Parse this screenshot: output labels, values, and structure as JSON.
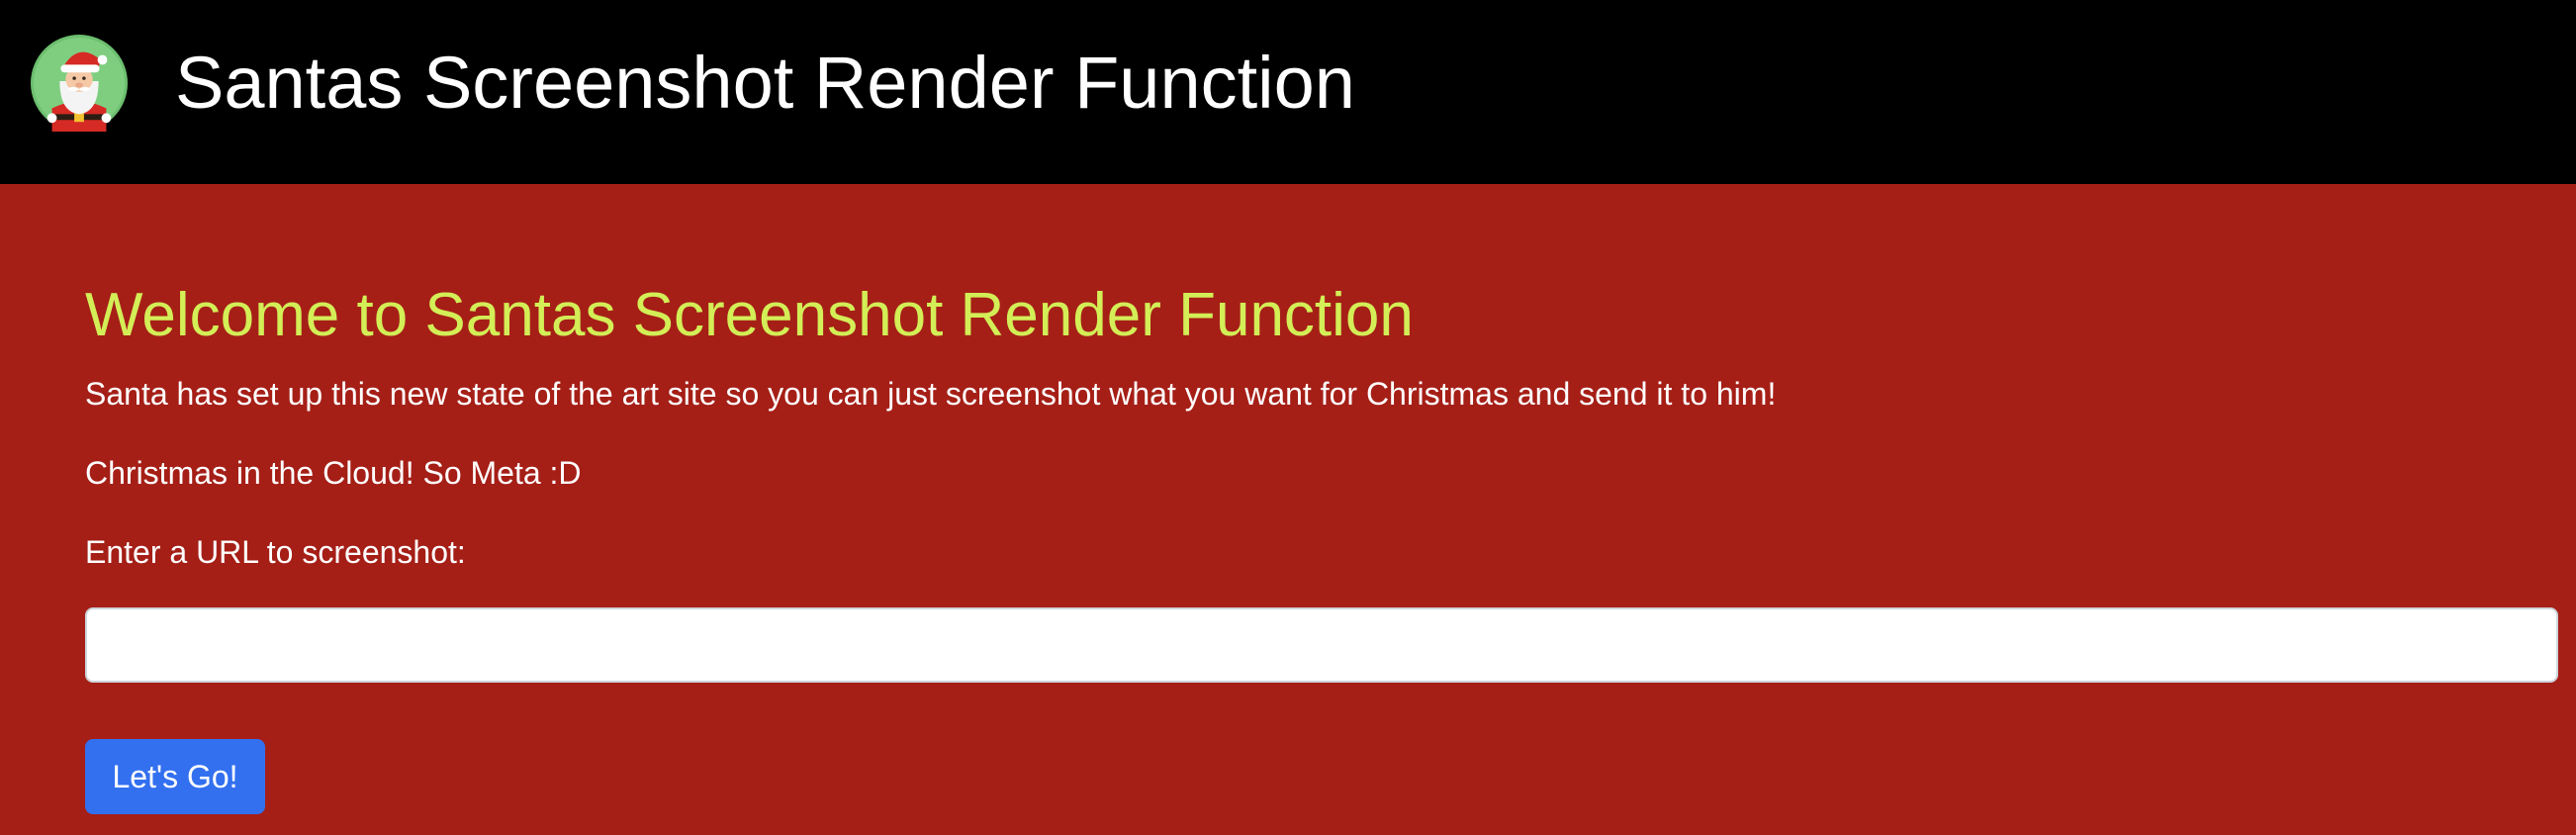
{
  "navbar": {
    "logo_icon": "santa-claus-icon",
    "title": "Santas Screenshot Render Function"
  },
  "main": {
    "heading": "Welcome to Santas Screenshot Render Function",
    "paragraphs": [
      "Santa has set up this new state of the art site so you can just screenshot what you want for Christmas and send it to him!",
      "Christmas in the Cloud! So Meta :D",
      "Enter a URL to screenshot:"
    ],
    "url_input": {
      "value": "",
      "placeholder": ""
    },
    "submit_label": "Let's Go!"
  },
  "colors": {
    "navbar_bg": "#000000",
    "page_bg": "#a51f17",
    "heading": "#d3ee56",
    "button": "#3370f0"
  }
}
